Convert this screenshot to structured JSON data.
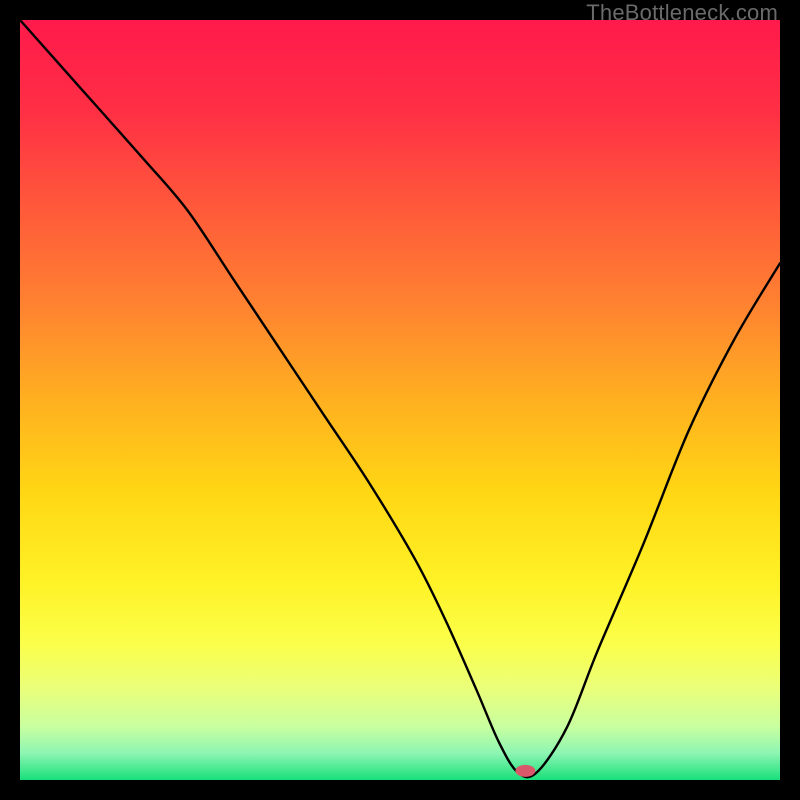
{
  "watermark": "TheBottleneck.com",
  "chart_data": {
    "type": "line",
    "title": "",
    "xlabel": "",
    "ylabel": "",
    "xlim": [
      0,
      100
    ],
    "ylim": [
      0,
      100
    ],
    "grid": false,
    "legend": false,
    "background_gradient": {
      "stops": [
        {
          "offset": 0.0,
          "color": "#ff1a4b"
        },
        {
          "offset": 0.12,
          "color": "#ff2f45"
        },
        {
          "offset": 0.25,
          "color": "#ff5a3a"
        },
        {
          "offset": 0.38,
          "color": "#ff8430"
        },
        {
          "offset": 0.5,
          "color": "#ffb020"
        },
        {
          "offset": 0.62,
          "color": "#ffd614"
        },
        {
          "offset": 0.74,
          "color": "#fff227"
        },
        {
          "offset": 0.82,
          "color": "#fbff4a"
        },
        {
          "offset": 0.88,
          "color": "#eaff7a"
        },
        {
          "offset": 0.93,
          "color": "#c8ffa0"
        },
        {
          "offset": 0.965,
          "color": "#8cf5b2"
        },
        {
          "offset": 1.0,
          "color": "#18e07a"
        }
      ]
    },
    "series": [
      {
        "name": "bottleneck-curve",
        "color": "#000000",
        "x": [
          0,
          8,
          16,
          22,
          28,
          34,
          40,
          46,
          52,
          56,
          60,
          63,
          65.5,
          68,
          72,
          76,
          82,
          88,
          94,
          100
        ],
        "values": [
          100,
          91,
          82,
          75,
          66,
          57,
          48,
          39,
          29,
          21,
          12,
          5,
          1,
          1,
          7,
          17,
          31,
          46,
          58,
          68
        ]
      }
    ],
    "marker": {
      "name": "optimal-point",
      "x": 66.5,
      "y": 1.2,
      "color": "#d9596a",
      "rx": 10,
      "ry": 6
    }
  }
}
